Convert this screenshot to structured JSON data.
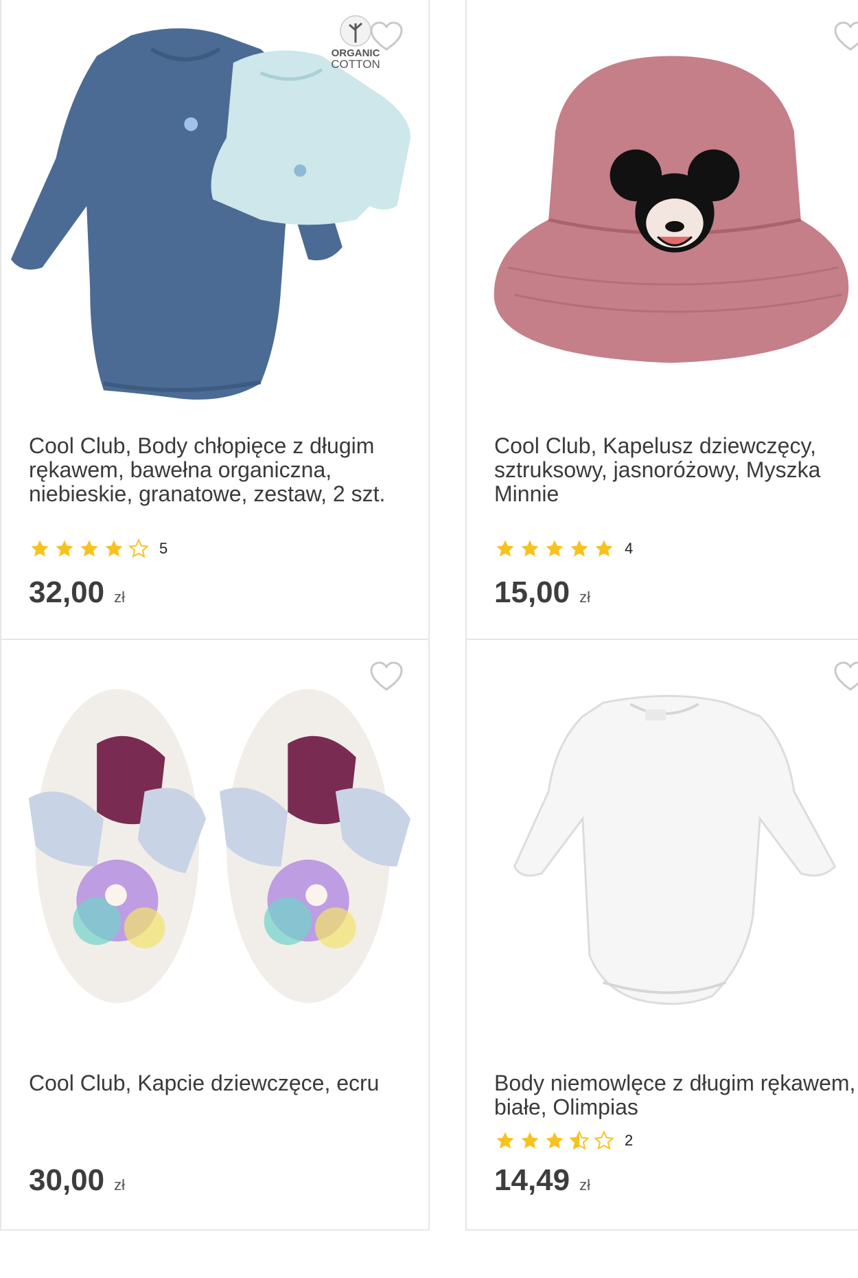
{
  "products": [
    {
      "title": "Cool Club, Body chłopięce z długim rękawem, bawełna organiczna, niebieskie, granatowe, zestaw, 2 szt.",
      "badge": [
        "ORGANIC",
        "COTTON"
      ],
      "rating": 4,
      "rating_count": "5",
      "price": "32,00",
      "currency": "zł"
    },
    {
      "title": "Cool Club, Kapelusz dziewczęcy, sztruksowy, jasnoróżowy, Myszka Minnie",
      "rating": 5,
      "rating_count": "4",
      "price": "15,00",
      "currency": "zł"
    },
    {
      "title": "Cool Club, Kapcie dziewczęce, ecru",
      "price": "30,00",
      "currency": "zł"
    },
    {
      "title": "Body niemowlęce z długim rękawem, białe, Olimpias",
      "rating": 3.5,
      "rating_count": "2",
      "price": "14,49",
      "currency": "zł"
    }
  ],
  "icons": {
    "favorite": "heart-outline-icon",
    "star": "star-icon"
  },
  "colors": {
    "star": "#f7c21e",
    "border": "#e6e6e6",
    "text": "#3a3a3a"
  }
}
